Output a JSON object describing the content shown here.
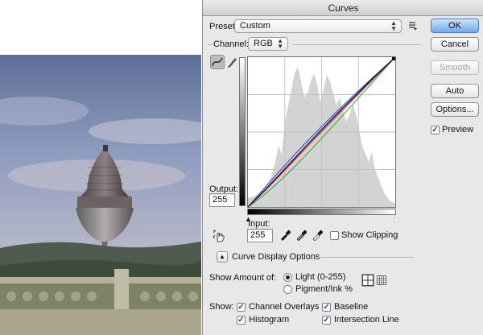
{
  "dialog": {
    "title": "Curves"
  },
  "preset": {
    "label": "Preset:",
    "value": "Custom"
  },
  "channel": {
    "label": "Channel:",
    "value": "RGB"
  },
  "buttons": {
    "ok": "OK",
    "cancel": "Cancel",
    "smooth": "Smooth",
    "auto": "Auto",
    "options": "Options..."
  },
  "preview": {
    "label": "Preview",
    "checked": true
  },
  "output": {
    "label": "Output:",
    "value": "255"
  },
  "input": {
    "label": "Input:",
    "value": "255"
  },
  "show_clipping": {
    "label": "Show Clipping",
    "checked": false
  },
  "curve_display": {
    "label": "Curve Display Options"
  },
  "show_amount": {
    "label": "Show Amount of:",
    "light": "Light  (0-255)",
    "pigment": "Pigment/Ink %",
    "selected": "light"
  },
  "show": {
    "label": "Show:",
    "channel_overlays": "Channel Overlays",
    "histogram": "Histogram",
    "baseline": "Baseline",
    "intersection_line": "Intersection Line"
  },
  "colors": {
    "ok_button": "#6fa9e8",
    "curve_red": "#d0204a",
    "curve_green": "#2ea02e",
    "curve_blue": "#2b45d0"
  },
  "icons": [
    "curve-tool-icon",
    "pencil-tool-icon",
    "target-adjust-icon",
    "black-eyedropper-icon",
    "gray-eyedropper-icon",
    "white-eyedropper-icon",
    "preset-options-icon",
    "disclosure-icon",
    "simple-grid-icon",
    "detailed-grid-icon"
  ]
}
